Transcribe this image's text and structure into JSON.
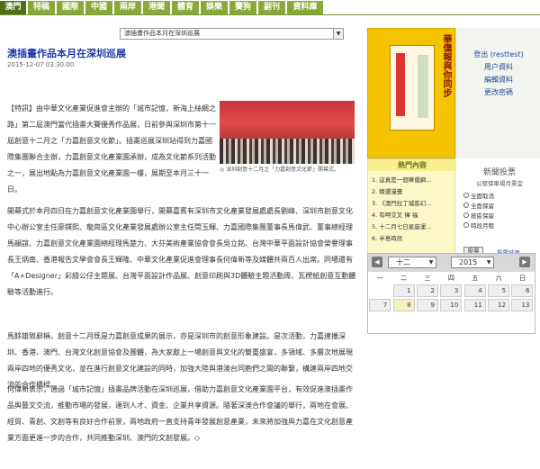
{
  "nav": {
    "items": [
      "澳門",
      "特稿",
      "國際",
      "中國",
      "兩岸",
      "港聞",
      "體育",
      "娛樂",
      "賽狗",
      "副刊",
      "資料庫"
    ],
    "widths": [
      29,
      30,
      30,
      30,
      30,
      30,
      30,
      30,
      30,
      30,
      40
    ]
  },
  "dropdown": {
    "selected": "澳插畫作品本月在深圳巡展"
  },
  "article": {
    "title": "澳插畫作品本月在深圳巡展",
    "date": "2015-12-07 03:30:00",
    "p1": "【特訊】由中華文化產業促進會主辦的「城市記憶，新海上絲綢之路」第二屆澳門當代插畫大賽優秀作品展，日前參與深圳市第十一屆創意十二月之「力嘉創意文化節」。插畫巡展深圳站得到力嘉國際集團聯合主辦，力嘉創意文化產業園承辦，成為文化節系列活動之一，展出地點為力嘉創意文化產業園一樓，展期至本月三十一日。",
    "caption": "◎ 深圳創意十二月之「力嘉創意文化節」開幕式。",
    "p2": "開幕式於本月四日在力嘉創意文化產業園舉行，開幕嘉賓有深圳市文化產業發展處處長劉峰、深圳市創意文化中心辦公室主任廖鏷熙、龍崗區文化產業發展處辦公室主任閆玉輝、力嘉國際集團董事長馬偉武、董事總經理馬韻誼、力嘉創意文化產業園總經理馬楚力、大芬美術產業協會會長吳立銘、台灣中華平面設計協會榮譽理事長王炳南、香港報告文學會會長王輝隆、中華文化產業促進會理事長何偉新等及媒體共兩百人出席。同場還有「A+Designer」彩繪公仔主題展、台灣平面設計作品展、創意印刷與3D體驗主題活動周、瓦楞紙創意互動體驗等活動進行。",
    "p3": "馬餘雄致辭稱，創意十二月既是力嘉創意成果的展示，亦是深圳市的創意形象建設。是次活動，力嘉連攜深圳、香港、澳門、台灣文化創意協會及團體，為大家獻上一場創意與文化的雙重盛宴，多領域、多層次地展現兩岸四地的優秀文化，並在進行創意文化建設的同時，加強大陸與港澳台同胞們之間的聯繫，構建兩岸四地交流的合作橋樑。",
    "p4": "何偉新表示，通過「城市記憶」插畫品牌活動在深圳巡展，借助力嘉創意文化產業園平台，有效促進澳插畫作品與藝文交流，推動市場的發展，達到人才、資金、企業共享資源。隨著深澳合作會議的舉行，兩地在會展、經貿、青創、文創等有良好合作前景，兩地政府一直支持青年發展創意產業，未來將加強與力嘉在文化創意產業方面更進一步的合作，共同推動深圳、澳門的文創發展。◇"
  },
  "cover": {
    "title": "華僑報與你同步"
  },
  "user": {
    "name": "登出 (resttest)",
    "links": [
      "用户資料",
      "編輯資料",
      "更改密碼"
    ]
  },
  "hot": {
    "heading": "熱門內容",
    "items": [
      "1. 這真是一個華僑網...",
      "2. 精選漫畫",
      "3. 《澳門拉丁城區幻...",
      "4. 有呷交叉 揮 福",
      "5. 十二月七日星座運...",
      "6. 半島時訊"
    ]
  },
  "poll": {
    "heading": "新聞投票",
    "question": "公眾保車場月票宜",
    "options": [
      "全面取消",
      "全面保留",
      "按區保留",
      "時段月租"
    ],
    "vote_label": "投票",
    "results_label": "投票結果"
  },
  "calendar": {
    "prev": "◀",
    "next": "▶",
    "month": "十二",
    "year": "2015",
    "dows": [
      "一",
      "二",
      "三",
      "四",
      "五",
      "六",
      "日"
    ],
    "days": [
      "",
      "1",
      "2",
      "3",
      "4",
      "5",
      "6",
      "7",
      "8",
      "9",
      "10",
      "11",
      "12",
      "13"
    ],
    "today": "8"
  }
}
